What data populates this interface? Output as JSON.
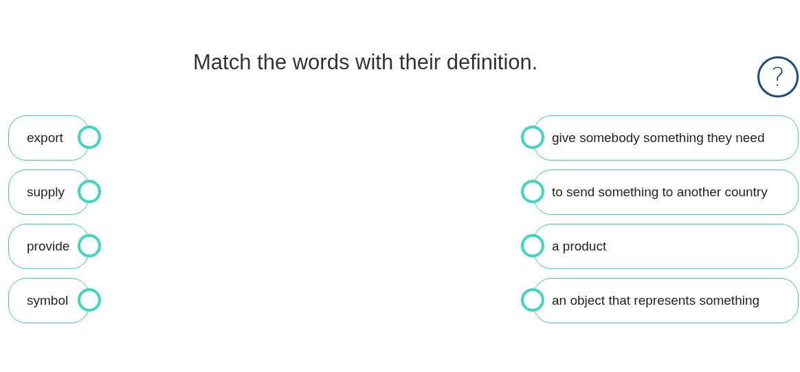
{
  "title": "Match the words with their definition.",
  "help_button": {
    "label": "?"
  },
  "words": [
    {
      "text": "export"
    },
    {
      "text": "supply"
    },
    {
      "text": "provide"
    },
    {
      "text": "symbol"
    }
  ],
  "definitions": [
    {
      "text": "give somebody something they need"
    },
    {
      "text": "to send something to another country"
    },
    {
      "text": "a product"
    },
    {
      "text": "an object that represents something"
    }
  ]
}
